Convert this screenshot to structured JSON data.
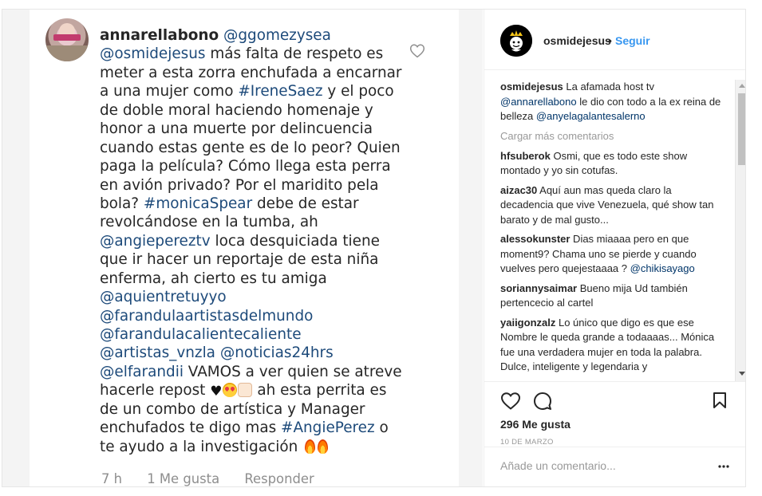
{
  "media": {
    "comment_user": "annarellabono",
    "lines": [
      [
        {
          "t": "annarellabono",
          "k": "user"
        },
        {
          "t": " ",
          "k": "text"
        },
        {
          "t": "@ggomezysea",
          "k": "mention"
        }
      ],
      [
        {
          "t": "@osmidejesus",
          "k": "mention"
        },
        {
          "t": " más falta de respeto es",
          "k": "text"
        }
      ],
      [
        {
          "t": "meter a esta zorra enchufada a encarnar",
          "k": "text"
        }
      ],
      [
        {
          "t": "a una mujer como ",
          "k": "text"
        },
        {
          "t": "#IreneSaez",
          "k": "mention"
        },
        {
          "t": " y el poco",
          "k": "text"
        }
      ],
      [
        {
          "t": "de doble moral haciendo homenaje y",
          "k": "text"
        }
      ],
      [
        {
          "t": "honor a una muerte por delincuencia",
          "k": "text"
        }
      ],
      [
        {
          "t": "cuando estas gente es de lo peor? Quien",
          "k": "text"
        }
      ],
      [
        {
          "t": "paga la película? Cómo llega esta perra",
          "k": "text"
        }
      ],
      [
        {
          "t": "en avión privado? Por el maridito pela",
          "k": "text"
        }
      ],
      [
        {
          "t": "bola? ",
          "k": "text"
        },
        {
          "t": "#monicaSpear",
          "k": "mention"
        },
        {
          "t": " debe de estar",
          "k": "text"
        }
      ],
      [
        {
          "t": "revolcándose en la tumba, ah",
          "k": "text"
        }
      ],
      [
        {
          "t": "@angiepereztv",
          "k": "mention"
        },
        {
          "t": " loca desquiciada tiene",
          "k": "text"
        }
      ],
      [
        {
          "t": "que ir hacer un reportaje de esta niña",
          "k": "text"
        }
      ],
      [
        {
          "t": "enferma, ah cierto es tu amiga",
          "k": "text"
        }
      ],
      [
        {
          "t": "@aquientretuyyo",
          "k": "mention"
        }
      ],
      [
        {
          "t": "@farandulaartistasdelmundo",
          "k": "mention"
        }
      ],
      [
        {
          "t": "@farandulacalientecaliente",
          "k": "mention"
        }
      ],
      [
        {
          "t": "@artistas_vnzla",
          "k": "mention"
        },
        {
          "t": " ",
          "k": "text"
        },
        {
          "t": "@noticias24hrs",
          "k": "mention"
        }
      ],
      [
        {
          "t": "@elfarandii",
          "k": "mention"
        },
        {
          "t": " VAMOS a ver quien se atreve",
          "k": "text"
        }
      ],
      [
        {
          "t": "hacerle repost ",
          "k": "text"
        },
        {
          "t": "♥",
          "k": "heart"
        },
        {
          "t": "",
          "k": "face"
        },
        {
          "t": "",
          "k": "clap"
        },
        {
          "t": "  ah esta perrita es",
          "k": "text"
        }
      ],
      [
        {
          "t": "de un combo de artística y Manager",
          "k": "text"
        }
      ],
      [
        {
          "t": "enchufados te digo mas ",
          "k": "text"
        },
        {
          "t": "#AngiePerez",
          "k": "mention"
        },
        {
          "t": " o",
          "k": "text"
        }
      ],
      [
        {
          "t": "te ayudo a la investigación ",
          "k": "text"
        },
        {
          "t": "",
          "k": "fire"
        },
        {
          "t": "",
          "k": "fire"
        }
      ]
    ],
    "footer": {
      "time": "7 h",
      "likes": "1 Me gusta",
      "reply": "Responder"
    }
  },
  "header": {
    "username": "osmidejesus",
    "separator": "•",
    "follow_label": "Seguir"
  },
  "caption": {
    "user": "osmidejesus",
    "parts": [
      {
        "t": " La afamada host tv ",
        "k": "text"
      },
      {
        "t": "@annarellabono",
        "k": "mention"
      },
      {
        "t": " le dio con todo a la ex reina de belleza ",
        "k": "text"
      },
      {
        "t": "@anyelagalantesalerno",
        "k": "mention"
      }
    ]
  },
  "load_more_label": "Cargar más comentarios",
  "comments": [
    {
      "user": "hfsuberok",
      "parts": [
        {
          "t": " Osmi, que es todo este show montado y yo sin cotufas.",
          "k": "text"
        }
      ]
    },
    {
      "user": "aizac30",
      "parts": [
        {
          "t": " Aquí aun mas queda claro la decadencia que vive Venezuela, qué show tan barato y de mal gusto...",
          "k": "text"
        }
      ]
    },
    {
      "user": "alessokunster",
      "parts": [
        {
          "t": " Dias miaaaa pero en que moment9? Chama uno se pierde y cuando vuelves pero quejestaaaa ? ",
          "k": "text"
        },
        {
          "t": "@chikisayago",
          "k": "mention"
        }
      ]
    },
    {
      "user": "soriannysaimar",
      "parts": [
        {
          "t": " Bueno mija Ud también pertencecio al cartel",
          "k": "text"
        }
      ]
    },
    {
      "user": "yaiigonzalz",
      "parts": [
        {
          "t": " Lo único que digo es que ese Nombre le queda grande a todaaaas... Mónica fue una verdadera mujer en toda la palabra. Dulce, inteligente y legendaria y",
          "k": "text"
        }
      ]
    }
  ],
  "likes_label": "296 Me gusta",
  "date_label": "10 DE MARZO",
  "comment_input": {
    "placeholder": "Añade un comentario...",
    "value": ""
  },
  "icons": {
    "like": "heart-icon",
    "comment": "comment-bubble-icon",
    "save": "bookmark-icon",
    "more": "more-options-icon",
    "media_like": "heart-outline-icon"
  },
  "colors": {
    "link": "#3897f0",
    "mention": "#003569",
    "muted": "#999999",
    "text": "#262626"
  }
}
